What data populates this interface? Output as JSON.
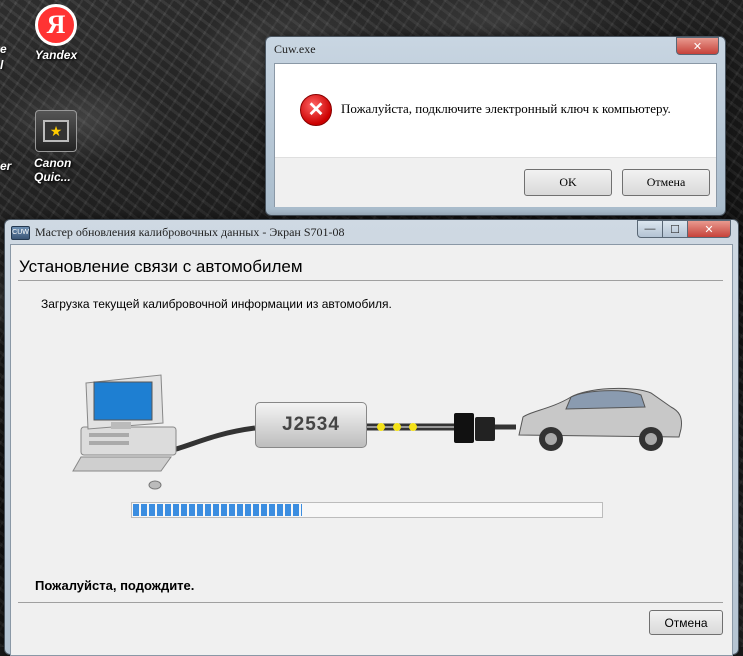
{
  "desktop": {
    "icons": [
      {
        "label": "Yandex"
      },
      {
        "label": "Canon Quic..."
      }
    ],
    "cut_labels": [
      "e",
      "l",
      "er"
    ]
  },
  "dialog": {
    "title": "Cuw.exe",
    "message": "Пожалуйста, подключите электронный ключ к компьютеру.",
    "ok_label": "OK",
    "cancel_label": "Отмена",
    "close_glyph": "✕"
  },
  "main_window": {
    "title": "Мастер обновления калибровочных данных - Экран S701-08",
    "controls": {
      "minimize": "—",
      "maximize": "☐",
      "close": "✕"
    },
    "heading": "Установление связи с автомобилем",
    "subtext": "Загрузка текущей калибровочной информации из автомобиля.",
    "device_label": "J2534",
    "progress": 0.36,
    "wait_text": "Пожалуйста, подождите.",
    "cancel_label": "Отмена"
  },
  "colors": {
    "progress_fill": "#3b8de0",
    "close_button": "#c7423a",
    "error_icon": "#cc0000"
  }
}
